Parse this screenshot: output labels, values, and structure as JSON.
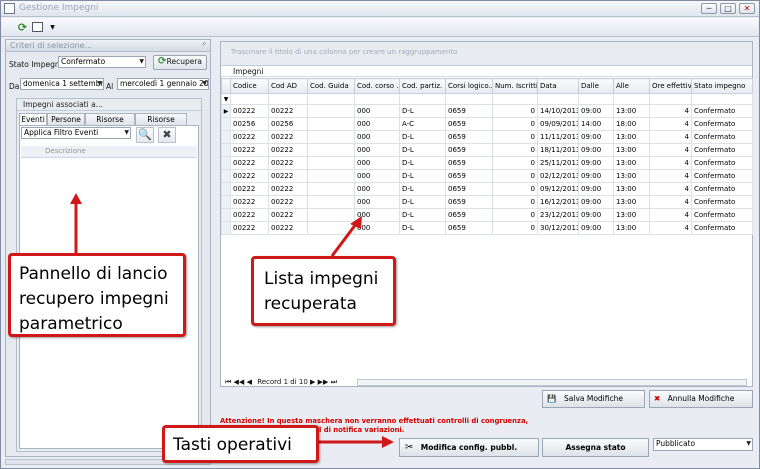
{
  "window": {
    "title": "Gestione Impegni",
    "buttons": [
      "─",
      "□",
      "✕"
    ]
  },
  "left_panel": {
    "title": "Criteri di selezione...",
    "stato_label": "Stato Impegno",
    "stato_value": "Confermato",
    "recupera_label": "Recupera",
    "dal_label": "Dal",
    "dal_value": "domenica 1 settembre",
    "al_label": "Al",
    "al_value": "mercoledì 1 gennaio 2014",
    "group_title": "Impegni associati a...",
    "tabs": [
      "Eventi",
      "Persone",
      "Risorse Fisse",
      "Risorse Mobili"
    ],
    "filter_value": "Applica Filtro Eventi",
    "desc_header": "Descrizione"
  },
  "grid": {
    "group_hint": "Trascinare il titolo di una colonna per creare un raggruppamento",
    "caption": "Impegni",
    "columns": [
      "Codice",
      "Cod AD",
      "Cod. Guida",
      "Cod. corso ...",
      "Cod. partiz.",
      "Corsi logico...",
      "Num. Iscritti",
      "Data",
      "Dalle",
      "Alle",
      "Ore effettive",
      "Stato impegno"
    ],
    "rows": [
      [
        "00222",
        "00222",
        "",
        "000",
        "D-L",
        "0659",
        "0",
        "14/10/2013",
        "09:00",
        "13:00",
        "4",
        "Confermato"
      ],
      [
        "00256",
        "00256",
        "",
        "000",
        "A-C",
        "0659",
        "0",
        "09/09/2013",
        "14:00",
        "18:00",
        "4",
        "Confermato"
      ],
      [
        "00222",
        "00222",
        "",
        "000",
        "D-L",
        "0659",
        "0",
        "11/11/2013",
        "09:00",
        "13:00",
        "4",
        "Confermato"
      ],
      [
        "00222",
        "00222",
        "",
        "000",
        "D-L",
        "0659",
        "0",
        "18/11/2013",
        "09:00",
        "13:00",
        "4",
        "Confermato"
      ],
      [
        "00222",
        "00222",
        "",
        "000",
        "D-L",
        "0659",
        "0",
        "25/11/2013",
        "09:00",
        "13:00",
        "4",
        "Confermato"
      ],
      [
        "00222",
        "00222",
        "",
        "000",
        "D-L",
        "0659",
        "0",
        "02/12/2013",
        "09:00",
        "13:00",
        "4",
        "Confermato"
      ],
      [
        "00222",
        "00222",
        "",
        "000",
        "D-L",
        "0659",
        "0",
        "09/12/2013",
        "09:00",
        "13:00",
        "4",
        "Confermato"
      ],
      [
        "00222",
        "00222",
        "",
        "000",
        "D-L",
        "0659",
        "0",
        "16/12/2013",
        "09:00",
        "13:00",
        "4",
        "Confermato"
      ],
      [
        "00222",
        "00222",
        "",
        "000",
        "D-L",
        "0659",
        "0",
        "23/12/2013",
        "09:00",
        "13:00",
        "4",
        "Confermato"
      ],
      [
        "00222",
        "00222",
        "",
        "000",
        "D-L",
        "0659",
        "0",
        "30/12/2013",
        "09:00",
        "13:00",
        "4",
        "Confermato"
      ]
    ],
    "record_text": "Record 1 di 10"
  },
  "actions": {
    "save": "Salva Modifiche",
    "undo": "Annulla Modifiche",
    "warning_line1": "Attenzione! In questa maschera non verranno effettuati controlli di congruenza,",
    "warning_line2": "né verranno inviate e-mail di notifica variazioni.",
    "modify": "Modifica config. pubbl.",
    "assign": "Assegna stato",
    "state_value": "Pubblicato"
  },
  "callouts": {
    "launch": "Pannello di lancio recupero impegni parametrico",
    "list": "Lista impegni recuperata",
    "buttons": "Tasti operativi"
  },
  "colors": {
    "callout_border": "#d01818",
    "warning": "#d40000",
    "accent_green": "#2e8b2e"
  }
}
